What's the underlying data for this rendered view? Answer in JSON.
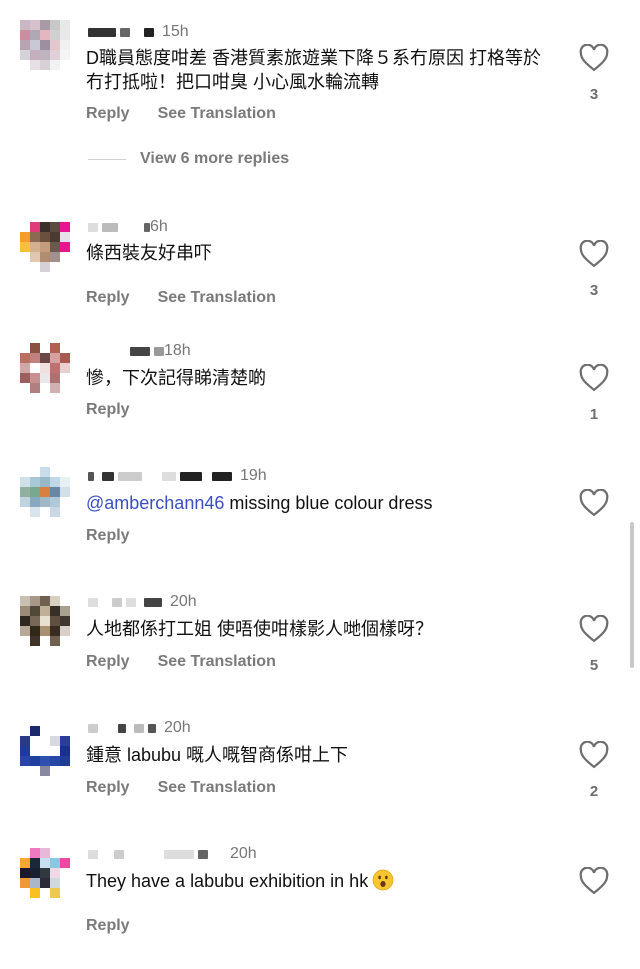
{
  "actions": {
    "reply": "Reply",
    "see_translation": "See Translation"
  },
  "comments": [
    {
      "time": "15h",
      "text": "D職員態度咁差 香港質素旅遊業下降５系冇原因 打格等於冇打抵啦！把口咁臭 小心風水輪流轉",
      "likes": "3",
      "view_more": "View 6 more replies",
      "avatar_colors": [
        "#c9b8c4",
        "#d7c1cc",
        "#a99aa8",
        "#c8c8c8",
        "#e8e8e8",
        "#c88fa0",
        "#b0a8b4",
        "#e3b6c0",
        "#d0d0d0",
        "#e8e8e8",
        "#b7a3b2",
        "#c9c9d6",
        "#9d8f9f",
        "#e4c6cd",
        "#f0f0f0",
        "#d3d3d8",
        "#c4b0bd",
        "#bfb3c0",
        "#e0d0d8",
        "#f4f4f4",
        "#ffffff",
        "#e6e0e4",
        "#d8d0d6",
        "#f2f2f2",
        "#ffffff"
      ]
    },
    {
      "time": "6h",
      "text": "條西裝友好串吓",
      "likes": "3",
      "avatar_colors": [
        "#ffffff",
        "#e03a7a",
        "#3a2f2a",
        "#5a4a40",
        "#e8168c",
        "#f59c2a",
        "#8c6a52",
        "#6b5040",
        "#4a3a32",
        "#e8e0e8",
        "#f7c03a",
        "#d4b090",
        "#c49c7c",
        "#6a5a50",
        "#e8168c",
        "#ffffff",
        "#e0c8b0",
        "#b08c70",
        "#a09090",
        "#ffffff",
        "#ffffff",
        "#ffffff",
        "#d8d0d8",
        "#ffffff",
        "#ffffff"
      ]
    },
    {
      "time": "18h",
      "text": "慘，下次記得睇清楚啲",
      "likes": "1",
      "avatar_colors": [
        "#ffffff",
        "#8a5040",
        "#ffffff",
        "#b06050",
        "#ffffff",
        "#b87060",
        "#c08080",
        "#6a4848",
        "#d8a0a0",
        "#a85a50",
        "#d0a8a8",
        "#ffffff",
        "#f0e0e0",
        "#c07070",
        "#e8d0d0",
        "#9a6060",
        "#c89090",
        "#e8e8e8",
        "#b07070",
        "#ffffff",
        "#ffffff",
        "#b08080",
        "#ffffff",
        "#d0b0b0",
        "#ffffff"
      ]
    },
    {
      "time": "19h",
      "text_prefix": "@amberchann46",
      "text": " missing blue colour dress",
      "avatar_colors": [
        "#ffffff",
        "#ffffff",
        "#c8dcea",
        "#ffffff",
        "#ffffff",
        "#d0e0e8",
        "#a8c8d8",
        "#98b8c8",
        "#c0d8e8",
        "#e8f0f4",
        "#90b0a0",
        "#78a890",
        "#d88040",
        "#6888a8",
        "#d0e0e8",
        "#c0d4e0",
        "#88a8c0",
        "#a0b8c8",
        "#b0c8d8",
        "#ffffff",
        "#ffffff",
        "#d8e4ec",
        "#ffffff",
        "#c8d8e4",
        "#ffffff"
      ]
    },
    {
      "time": "20h",
      "text": "人地都係打工姐 使唔使咁樣影人哋個樣呀？",
      "likes": "5",
      "avatar_colors": [
        "#c8c0b0",
        "#a89888",
        "#706050",
        "#d8d0c0",
        "#ffffff",
        "#9a8a78",
        "#504838",
        "#c0b098",
        "#383028",
        "#a8a090",
        "#302820",
        "#786858",
        "#e8e0d0",
        "#605040",
        "#403830",
        "#b8a898",
        "#302818",
        "#a89070",
        "#382c20",
        "#d8d0c8",
        "#ffffff",
        "#403428",
        "#ffffff",
        "#706050",
        "#ffffff"
      ]
    },
    {
      "time": "20h",
      "text": "鍾意 labubu 嘅人嘅智商係咁上下",
      "likes": "2",
      "avatar_colors": [
        "#ffffff",
        "#1a2a6a",
        "#ffffff",
        "#ffffff",
        "#ffffff",
        "#2a3a8a",
        "#ffffff",
        "#ffffff",
        "#d8d8e0",
        "#2a3c9c",
        "#1e3a9a",
        "#ffffff",
        "#ffffff",
        "#ffffff",
        "#1a3090",
        "#2a44a8",
        "#2040a0",
        "#3050b0",
        "#2848a8",
        "#203c98",
        "#ffffff",
        "#ffffff",
        "#8888a0",
        "#ffffff",
        "#ffffff"
      ]
    },
    {
      "time": "20h",
      "text": "They have a labubu exhibition in hk",
      "avatar_colors": [
        "#ffffff",
        "#f078c0",
        "#e8b8d8",
        "#ffffff",
        "#ffffff",
        "#f8a830",
        "#1a2838",
        "#c8e0f0",
        "#88c8e0",
        "#f048a0",
        "#1a1a2a",
        "#1a2030",
        "#303840",
        "#f0d8e8",
        "#ffffff",
        "#f09838",
        "#a8b8c8",
        "#2a2a38",
        "#d0d8e0",
        "#ffffff",
        "#ffffff",
        "#f8c020",
        "#ffffff",
        "#f0c850",
        "#ffffff"
      ]
    }
  ]
}
